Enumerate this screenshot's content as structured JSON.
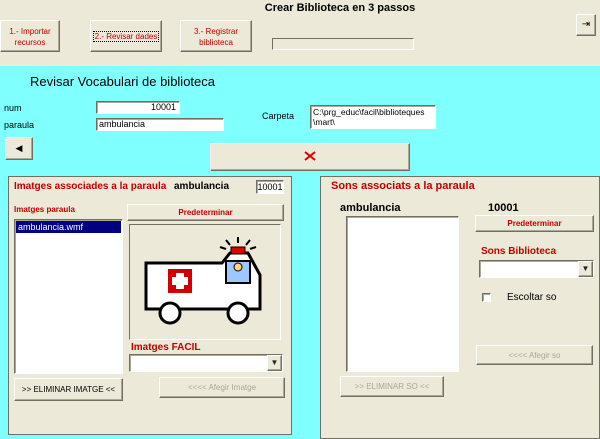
{
  "header": {
    "title": "Crear Biblioteca en 3 passos",
    "steps": [
      {
        "label": "1.- Importar recursos"
      },
      {
        "label": "2.- Revisar dades"
      },
      {
        "label": "3.- Registrar biblioteca"
      }
    ]
  },
  "panel": {
    "title": "Revisar Vocabulari de biblioteca",
    "num_label": "num",
    "num_value": "10001",
    "paraula_label": "paraula",
    "paraula_value": "ambulancia",
    "carpeta_label": "Carpeta",
    "carpeta_value": "C:\\prg_educ\\facil\\biblioteques\\mart\\"
  },
  "images": {
    "title": "Imatges associades a la paraula",
    "word": "ambulancia",
    "num": "10001",
    "list_label": "Imatges paraula",
    "items": [
      "ambulancia.wmf"
    ],
    "default_button": "Predeterminar",
    "facil_label": "Imatges FACIL",
    "remove_button": ">> ELIMINAR IMATGE <<",
    "add_button": "<<<< Afegir Imatge"
  },
  "sounds": {
    "title": "Sons associats a la paraula",
    "word": "ambulancia",
    "num": "10001",
    "default_button": "Predeterminar",
    "library_label": "Sons  Biblioteca",
    "listen_label": "Escoltar so",
    "add_button": "<<<< Afegir so",
    "remove_button": ">> ELIMINAR SO <<"
  }
}
